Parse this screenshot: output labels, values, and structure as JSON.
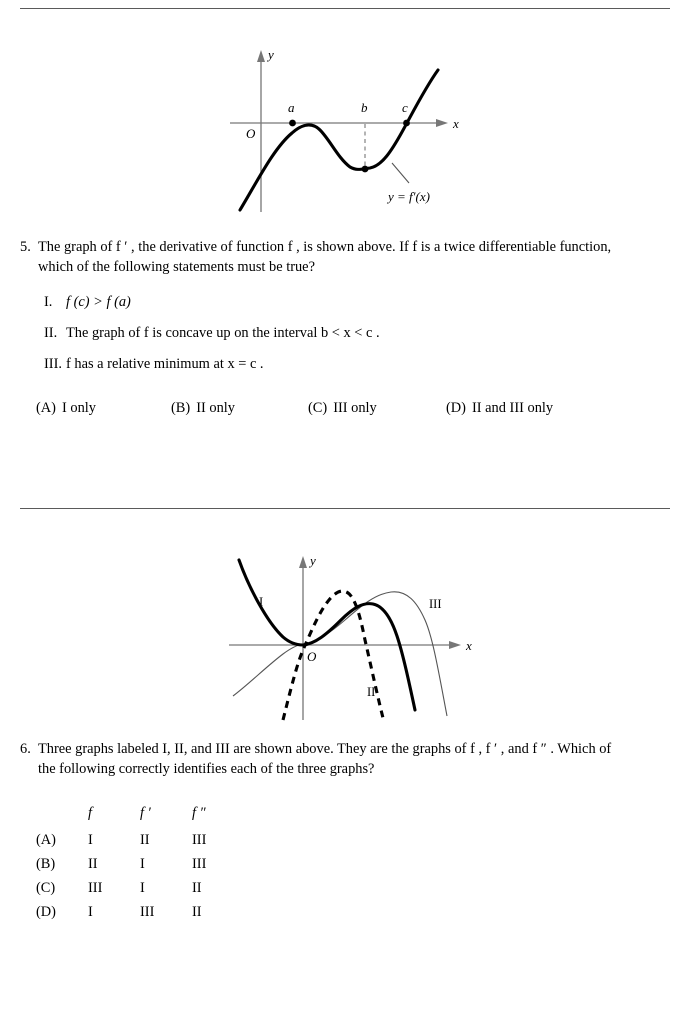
{
  "page": {
    "divider_top": "horizontal-rule",
    "divider_middle": "horizontal-rule"
  },
  "question5": {
    "number": "5.",
    "line1": "The graph of  f ′ , the derivative of function  f , is shown above. If  f  is a twice differentiable function,",
    "line2": "which of the following statements must be true?",
    "statements": [
      {
        "num": "I.",
        "text": "f (c) > f (a)"
      },
      {
        "num": "II.",
        "text": "The graph of  f  is concave up on the interval  b < x < c ."
      },
      {
        "num": "III.",
        "text": "f  has a relative minimum at  x = c ."
      }
    ],
    "choices": [
      {
        "label": "(A)",
        "text": "I only"
      },
      {
        "label": "(B)",
        "text": "II only"
      },
      {
        "label": "(C)",
        "text": "III only"
      },
      {
        "label": "(D)",
        "text": "II and III only"
      }
    ]
  },
  "figure5": {
    "caption": "y = f ′(x)",
    "axis_x_label": "x",
    "axis_y_label": "y",
    "origin_label": "O",
    "point_labels": [
      "a",
      "b",
      "c"
    ],
    "description": "Graph of the derivative f prime: rises from lower left, local maximum touching the x-axis at a, decreases to a local minimum at b below the axis, then increases crossing the x-axis at c and continues upward."
  },
  "question6": {
    "number": "6.",
    "line1": "Three graphs labeled I, II, and III are shown above. They are the graphs of  f , f ′ , and  f ″ . Which of",
    "line2": "the following correctly identifies each of the three graphs?",
    "table": {
      "headers": [
        "f",
        "f ′",
        "f ″"
      ],
      "rows": [
        {
          "label": "(A)",
          "values": [
            "I",
            "II",
            "III"
          ]
        },
        {
          "label": "(B)",
          "values": [
            "II",
            "I",
            "III"
          ]
        },
        {
          "label": "(C)",
          "values": [
            "III",
            "I",
            "II"
          ]
        },
        {
          "label": "(D)",
          "values": [
            "I",
            "III",
            "II"
          ]
        }
      ]
    }
  },
  "figure6": {
    "axis_x_label": "x",
    "axis_y_label": "y",
    "origin_label": "O",
    "curve_labels": [
      "I",
      "II",
      "III"
    ],
    "description": "Three curves through the origin: curve I is a thick upward parabola-like curve opening up on the left, curve II is a dashed steeply rising then falling curve, curve III is a thin gradually rising curve with a later maximum."
  },
  "colors": {
    "rule": "#5a5a5a",
    "axis": "#777777",
    "curve_bold": "#000000",
    "curve_thin": "#555555",
    "text": "#000000"
  }
}
